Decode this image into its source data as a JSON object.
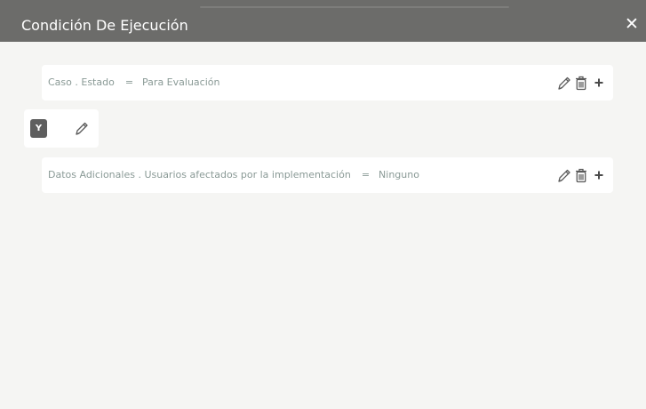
{
  "dialog": {
    "title": "Condición De Ejecución",
    "close_label": "✕"
  },
  "conditions": [
    {
      "field": "Caso . Estado",
      "operator": "=",
      "value": "Para Evaluación"
    },
    {
      "field": "Datos Adicionales . Usuarios afectados por la implementación",
      "operator": "=",
      "value": "Ninguno"
    }
  ],
  "logic": {
    "operator_label": "Y"
  },
  "icons": {
    "edit": "pencil-icon",
    "delete": "trash-icon",
    "add": "plus-icon",
    "close": "close-icon"
  },
  "colors": {
    "header_bg": "#6c6c6a",
    "page_bg": "#f5f5f3",
    "row_bg": "#ffffff",
    "condition_text": "#8a9a96",
    "badge_bg": "#5e5e5e",
    "icon": "#5a5a5a"
  }
}
